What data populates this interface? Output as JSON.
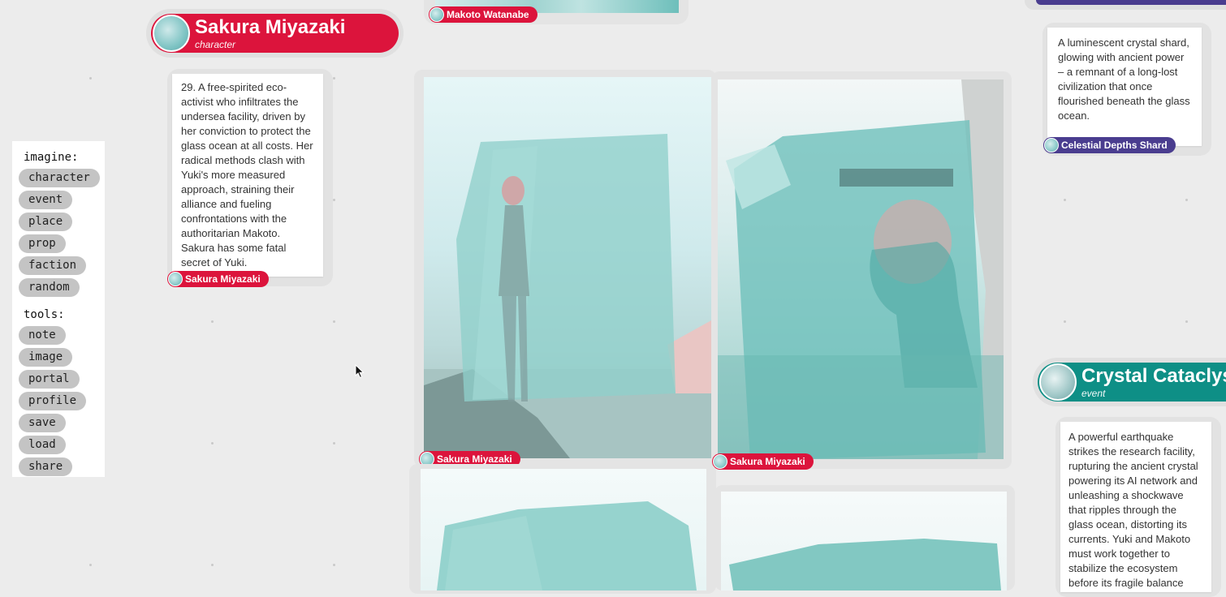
{
  "toolbar": {
    "imagine_label": "imagine:",
    "imagine_items": [
      "character",
      "event",
      "place",
      "prop",
      "faction",
      "random"
    ],
    "tools_label": "tools:",
    "tools_items": [
      "note",
      "image",
      "portal",
      "profile",
      "save",
      "load",
      "share"
    ]
  },
  "profile": {
    "name": "Sakura Miyazaki",
    "kind": "character",
    "description": "29. A free-spirited eco-activist who infiltrates the undersea facility, driven by her conviction to protect the glass ocean at all costs. Her radical methods clash with Yuki's more measured approach, straining their alliance and fueling confrontations with the authoritarian Makoto. Sakura has some fatal secret of Yuki.",
    "tag": "Sakura Miyazaki"
  },
  "top_strip": {
    "tag": "Makoto Watanabe"
  },
  "images": {
    "left_tag": "Sakura Miyazaki",
    "right_tag": "Sakura Miyazaki"
  },
  "shard": {
    "description": "A luminescent crystal shard, glowing with ancient power – a remnant of a long-lost civilization that once flourished beneath the glass ocean.",
    "tag": "Celestial Depths Shard"
  },
  "event": {
    "name": "Crystal Cataclysm",
    "kind": "event",
    "description": "A powerful earthquake strikes the research facility, rupturing the ancient crystal powering its AI network and unleashing a shockwave that ripples through the glass ocean, distorting its currents. Yuki and Makoto must work together to stabilize the ecosystem before its fragile balance collapses."
  },
  "colors": {
    "character_accent": "#dc143c",
    "prop_accent": "#4a3d8f",
    "event_accent": "#0e8f86",
    "background": "#ececec"
  }
}
